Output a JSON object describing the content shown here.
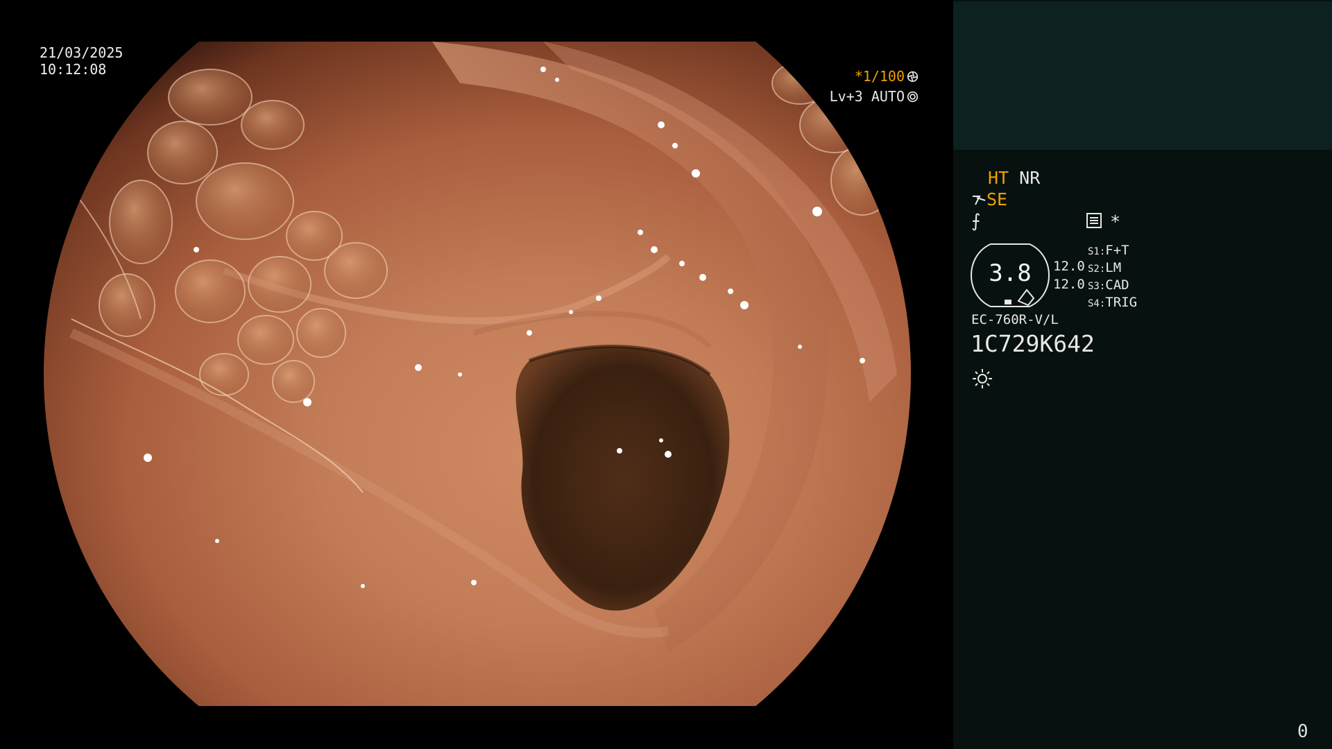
{
  "overlay": {
    "date": "21/03/2025",
    "time": "10:12:08",
    "shutter": "*1/100",
    "level": "Lv+3 AUTO"
  },
  "panel": {
    "mode_ht": "HT",
    "mode_nr": "NR",
    "mode_se": "SE",
    "f_symbol": "⨍",
    "asterisk": "*",
    "zoom_value": "3.8",
    "value_1": "12.0",
    "value_2": "12.0",
    "settings": [
      {
        "key": "S1:",
        "value": "F+T"
      },
      {
        "key": "S2:",
        "value": "LM"
      },
      {
        "key": "S3:",
        "value": "CAD"
      },
      {
        "key": "S4:",
        "value": "TRIG"
      }
    ],
    "scope_model": "EC-760R-V/L",
    "serial": "1C729K642",
    "counter": "0"
  },
  "colors": {
    "accent": "#f0a000",
    "panel_top": "#0c2120",
    "panel_bg": "#07110f"
  },
  "icons": {
    "shutter": "aperture-icon",
    "level": "iris-icon",
    "menu": "menu-list-icon",
    "light": "light-sun-icon"
  }
}
